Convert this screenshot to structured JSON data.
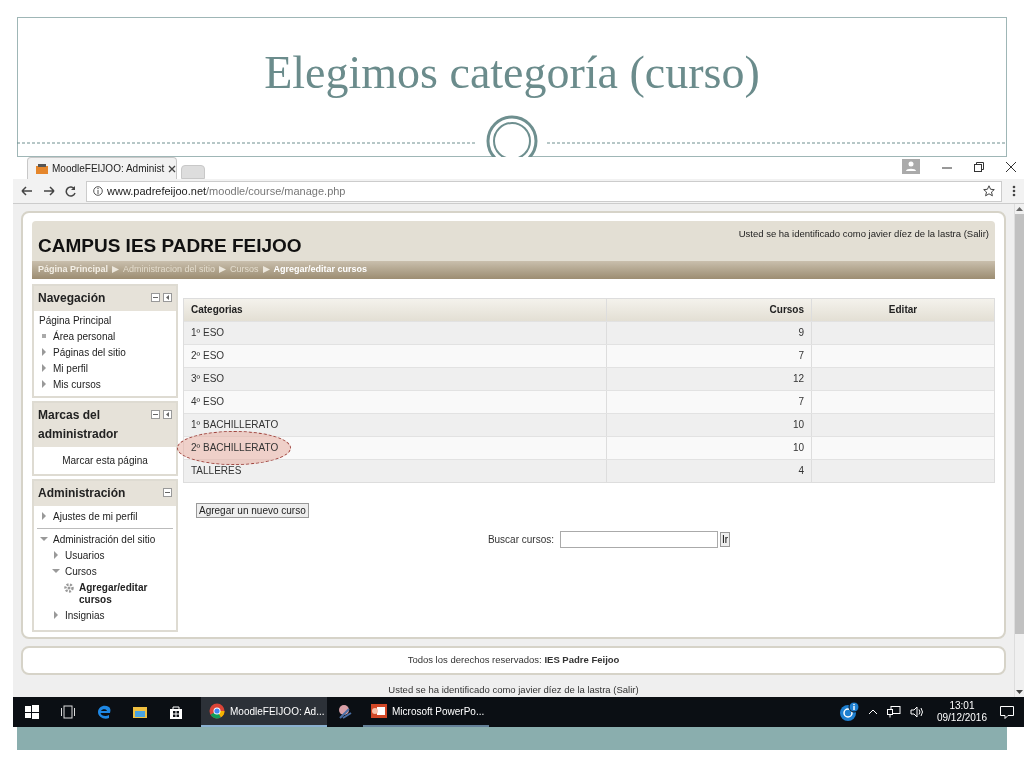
{
  "slide": {
    "title": "Elegimos categoría (curso)"
  },
  "browser": {
    "tab_title": "MoodleFEIJOO: Administ",
    "url_host": "www.padrefeijoo.net",
    "url_path": "/moodle/course/manage.php"
  },
  "site": {
    "name": "CAMPUS IES PADRE FEIJOO",
    "login_info": "Usted se ha identificado como javier díez de la lastra (Salir)",
    "breadcrumb": [
      {
        "label": "Página Principal",
        "current": false
      },
      {
        "label": "Administracion del sitio",
        "current": false
      },
      {
        "label": "Cursos",
        "current": false
      },
      {
        "label": "Agregar/editar cursos",
        "current": true
      }
    ]
  },
  "navigation": {
    "title": "Navegación",
    "items": [
      {
        "label": "Página Principal",
        "kind": "plain"
      },
      {
        "label": "Área personal",
        "kind": "leaf"
      },
      {
        "label": "Páginas del sitio",
        "kind": "branch",
        "expanded": false
      },
      {
        "label": "Mi perfil",
        "kind": "branch",
        "expanded": false
      },
      {
        "label": "Mis cursos",
        "kind": "branch",
        "expanded": false
      }
    ]
  },
  "admin_bookmarks": {
    "title": "Marcas del administrador",
    "link": "Marcar esta página"
  },
  "administration": {
    "title": "Administración",
    "items": [
      {
        "label": "Ajustes de mi perfil",
        "kind": "branch",
        "expanded": false
      },
      {
        "label": "Administración del sitio",
        "kind": "branch",
        "expanded": true,
        "children": [
          {
            "label": "Usuarios",
            "kind": "branch",
            "expanded": false
          },
          {
            "label": "Cursos",
            "kind": "branch",
            "expanded": true,
            "children": [
              {
                "label": "Agregar/editar cursos",
                "kind": "setting"
              }
            ]
          },
          {
            "label": "Insignias",
            "kind": "branch",
            "expanded": false
          }
        ]
      }
    ]
  },
  "table": {
    "columns": [
      "Categorias",
      "Cursos",
      "Editar"
    ],
    "rows": [
      {
        "category": "1º ESO",
        "courses": "9",
        "highlighted": false
      },
      {
        "category": "2º ESO",
        "courses": "7",
        "highlighted": false
      },
      {
        "category": "3º ESO",
        "courses": "12",
        "highlighted": false
      },
      {
        "category": "4º ESO",
        "courses": "7",
        "highlighted": false
      },
      {
        "category": "1º BACHILLERATO",
        "courses": "10",
        "highlighted": false
      },
      {
        "category": "2º BACHILLERATO",
        "courses": "10",
        "highlighted": true
      },
      {
        "category": "TALLERES",
        "courses": "4",
        "highlighted": false
      }
    ]
  },
  "add_course_button": "Agregar un nuevo curso",
  "search": {
    "label": "Buscar cursos:",
    "button": "Ir"
  },
  "footer": {
    "text": "Todos los derechos reservados: **IES Padre Feijoo**",
    "login_info": "Usted se ha identificado como javier díez de la lastra (Salir)"
  },
  "taskbar": {
    "apps": [
      {
        "label": "MoodleFEIJOO: Ad...",
        "kind": "browser",
        "active": true
      },
      {
        "label": "Microsoft PowerPo...",
        "kind": "powerpoint",
        "active": false
      }
    ],
    "time": "13:01",
    "date": "09/12/2016"
  }
}
